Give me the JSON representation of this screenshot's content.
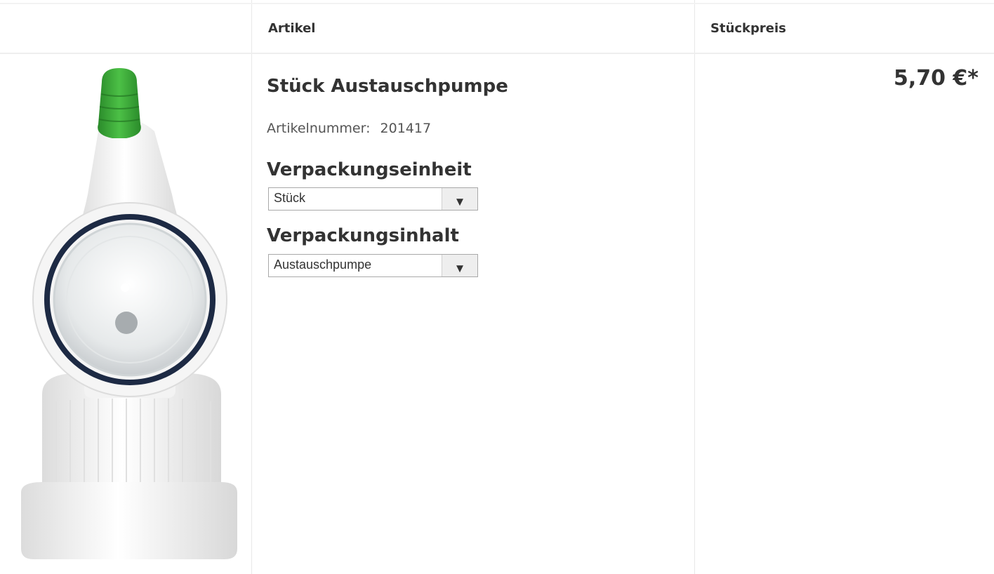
{
  "table": {
    "headers": {
      "article": "Artikel",
      "unit_price": "Stückpreis"
    }
  },
  "product": {
    "name": "Stück Austauschpumpe",
    "article_number_label": "Artikelnummer:",
    "article_number": "201417",
    "packaging_unit_heading": "Verpackungseinheit",
    "packaging_unit_value": "Stück",
    "packaging_content_heading": "Verpackungsinhalt",
    "packaging_content_value": "Austauschpumpe",
    "price": "5,70 €*",
    "image_icon": "replacement-pump-photo",
    "dropdown_arrow": "▼"
  },
  "colors": {
    "cap_green": "#3aa537",
    "body_white": "#f7f7f7",
    "seal_dark": "#1d2a44"
  }
}
